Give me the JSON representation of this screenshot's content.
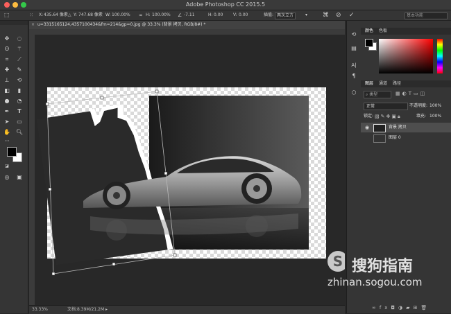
{
  "titlebar": {
    "title": "Adobe Photoshop CC 2015.5"
  },
  "options": {
    "x_label": "X:",
    "x_value": "435.64 像素",
    "y_label": "Y:",
    "y_value": "747.68 像素",
    "w_label": "W:",
    "w_value": "100.00%",
    "h_label": "H:",
    "h_value": "100.00%",
    "angle_value": "-7.11",
    "hskew_label": "H:",
    "hskew_value": "0.00",
    "vskew_label": "V:",
    "vskew_value": "0.00",
    "interp_label": "插值:",
    "interp_value": "两次立方",
    "workspace": "基本功能"
  },
  "document_tab": {
    "title": "u=3315165124,4357100434&fm=214&gp=0.jpg @ 33.3% (背景 拷贝, RGB/8#) *"
  },
  "status": {
    "zoom": "33.33%",
    "doc": "文档:8.39M/21.2M"
  },
  "panels": {
    "color_tabs": [
      "颜色",
      "色板"
    ],
    "layers_tabs": [
      "图层",
      "通道",
      "路径"
    ],
    "kind": "类型",
    "blend_mode": "正常",
    "opacity_label": "不透明度:",
    "opacity_value": "100%",
    "lock_label": "锁定:",
    "fill_label": "填充:",
    "fill_value": "100%",
    "layers": [
      {
        "name": "背景 拷贝",
        "selected": true
      },
      {
        "name": "图层 0",
        "selected": false
      }
    ]
  },
  "watermark": {
    "brand": "搜狗指南",
    "url": "zhinan.sogou.com"
  }
}
